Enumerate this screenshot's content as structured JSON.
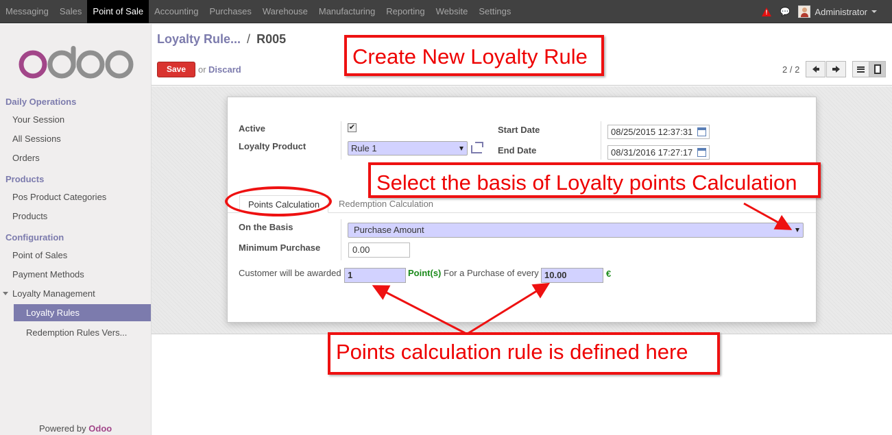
{
  "topbar": {
    "menu": [
      "Messaging",
      "Sales",
      "Point of Sale",
      "Accounting",
      "Purchases",
      "Warehouse",
      "Manufacturing",
      "Reporting",
      "Website",
      "Settings"
    ],
    "active_menu": "Point of Sale",
    "user": "Administrator"
  },
  "sidebar": {
    "logo": "odoo",
    "sections": [
      {
        "title": "Daily Operations",
        "items": [
          "Your Session",
          "All Sessions",
          "Orders"
        ]
      },
      {
        "title": "Products",
        "items": [
          "Pos Product Categories",
          "Products"
        ]
      },
      {
        "title": "Configuration",
        "items": [
          "Point of Sales",
          "Payment Methods",
          "Loyalty Management",
          "Loyalty Rules",
          "Redemption Rules Vers..."
        ]
      }
    ],
    "active_item": "Loyalty Rules",
    "powered_by": "Powered by",
    "powered_brand": "Odoo"
  },
  "header": {
    "breadcrumb_parent": "Loyalty Rule...",
    "breadcrumb_sep": "/",
    "breadcrumb_current": "R005",
    "save_label": "Save",
    "or_label": "or",
    "discard_label": "Discard",
    "pager": "2 / 2"
  },
  "form": {
    "active_label": "Active",
    "active_checked": true,
    "loyalty_product_label": "Loyalty Product",
    "loyalty_product_value": "Rule 1",
    "start_date_label": "Start Date",
    "start_date_value": "08/25/2015 12:37:31",
    "end_date_label": "End Date",
    "end_date_value": "08/31/2016 17:27:17",
    "tabs": [
      "Points Calculation",
      "Redemption Calculation"
    ],
    "active_tab": "Points Calculation",
    "basis_label": "On the Basis",
    "basis_value": "Purchase Amount",
    "min_purchase_label": "Minimum Purchase",
    "min_purchase_value": "0.00",
    "awarded_label": "Customer will be awarded",
    "points_value": "1",
    "points_unit": "Point(s)",
    "purchase_label": "For a Purchase of every",
    "purchase_value": "10.00",
    "currency": "€"
  },
  "annotations": {
    "title": "Create New Loyalty Rule",
    "basis_note": "Select the basis of Loyalty points Calculation",
    "rule_note": "Points calculation rule is defined here",
    "color": "#e11111"
  }
}
